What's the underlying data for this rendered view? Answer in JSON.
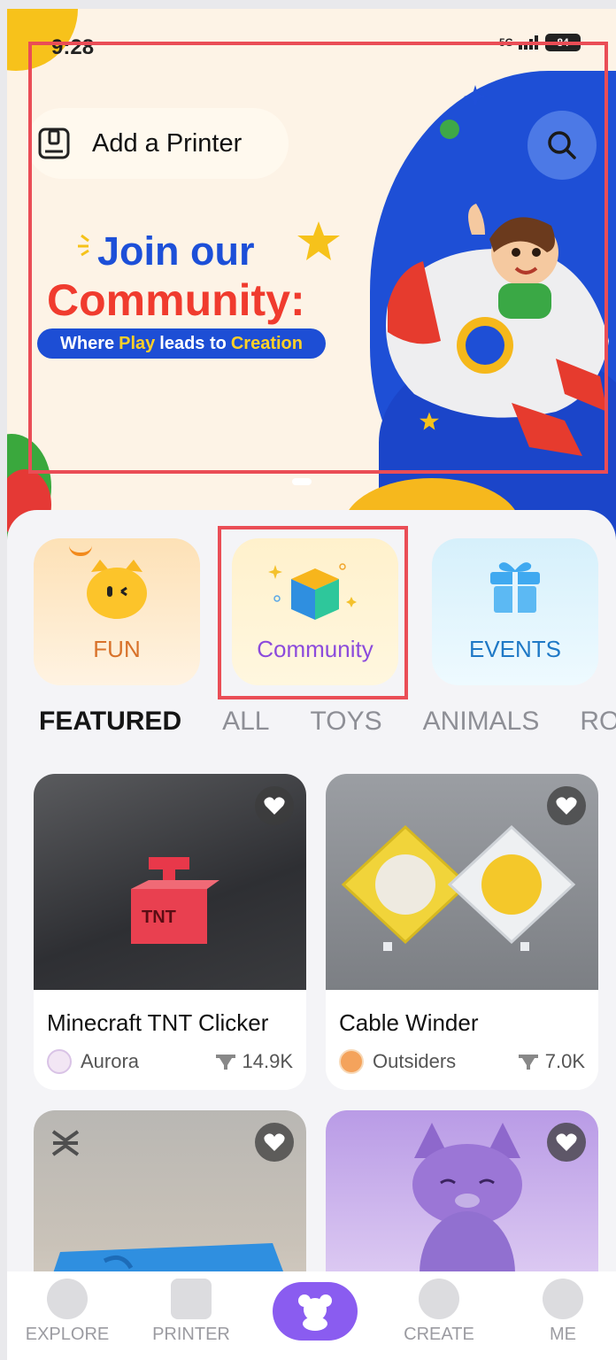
{
  "status_bar": {
    "time": "9:28",
    "network": "5G",
    "battery": "84"
  },
  "banner": {
    "add_printer_label": "Add a Printer",
    "headline_line1": "Join our",
    "headline_line2": "Community:",
    "tagline_pre": "Where",
    "tagline_play": "Play",
    "tagline_mid": "leads to",
    "tagline_creation": "Creation"
  },
  "categories": [
    {
      "label": "FUN",
      "icon": "cat-face-icon"
    },
    {
      "label": "Community",
      "icon": "cube-icon"
    },
    {
      "label": "EVENTS",
      "icon": "gift-icon"
    }
  ],
  "tabs": [
    "FEATURED",
    "ALL",
    "TOYS",
    "ANIMALS",
    "ROBO"
  ],
  "active_tab": "FEATURED",
  "cards": [
    {
      "title": "Minecraft TNT Clicker",
      "author": "Aurora",
      "downloads": "14.9K"
    },
    {
      "title": "Cable Winder",
      "author": "Outsiders",
      "downloads": "7.0K"
    },
    {
      "title": "",
      "author": "",
      "downloads": ""
    },
    {
      "title": "",
      "author": "",
      "downloads": ""
    }
  ],
  "bottom_nav": [
    {
      "label": "EXPLORE"
    },
    {
      "label": "PRINTER"
    },
    {
      "label": ""
    },
    {
      "label": "CREATE"
    },
    {
      "label": "ME"
    }
  ],
  "colors": {
    "accent_purple": "#8a5cf0",
    "headline_blue": "#1c4fd8",
    "headline_red": "#f03b2e",
    "highlight_outline": "#ea4d56",
    "tab_underline": "#f28a1c"
  }
}
